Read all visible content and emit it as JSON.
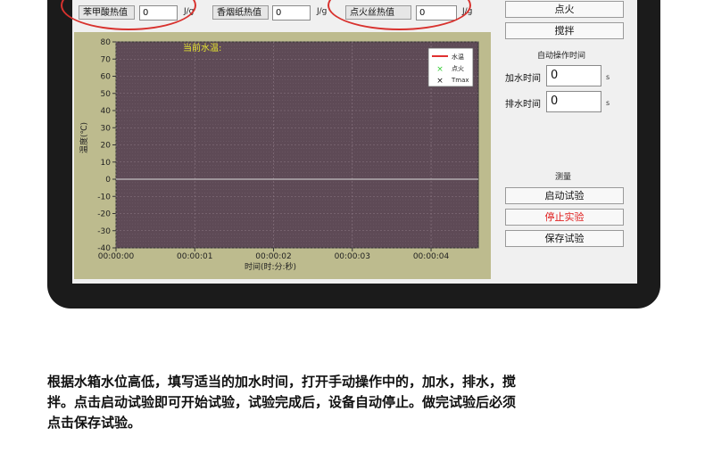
{
  "top_fields": [
    {
      "label": "苯甲酸热值",
      "value": "0",
      "unit": "J/g"
    },
    {
      "label": "香烟纸热值",
      "value": "0",
      "unit": "J/g"
    },
    {
      "label": "点火丝热值",
      "value": "0",
      "unit": "J/g"
    }
  ],
  "right_panel": {
    "ignite_label": "点火",
    "stir_label": "搅拌",
    "auto_title": "自动操作时间",
    "add_water_label": "加水时间",
    "add_water_value": "0",
    "add_water_unit": "s",
    "drain_label": "排水时间",
    "drain_value": "0",
    "drain_unit": "s",
    "measure_title": "测量",
    "start_label": "启动试验",
    "stop_label": "停止实验",
    "save_label": "保存试验"
  },
  "chart_data": {
    "type": "line",
    "annotation": "当前水温:",
    "xlabel": "时间(时:分:秒)",
    "ylabel": "温度(℃)",
    "x_ticks": [
      "00:00:00",
      "00:00:01",
      "00:00:02",
      "00:00:03",
      "00:00:04"
    ],
    "y_ticks": [
      80,
      70,
      60,
      50,
      40,
      30,
      20,
      10,
      0,
      -10,
      -20,
      -30,
      -40
    ],
    "ylim": [
      -40,
      80
    ],
    "xlim": [
      0,
      4.6
    ],
    "grid": true,
    "legend_position": "top-right",
    "legend": [
      {
        "name": "水温",
        "marker": "line",
        "color": "#e03030"
      },
      {
        "name": "点火",
        "marker": "x",
        "color": "#33cc33"
      },
      {
        "name": "Tmax",
        "marker": "x",
        "color": "#111111"
      }
    ],
    "series": [
      {
        "name": "水温",
        "x": [
          0,
          4.6
        ],
        "y": [
          0,
          0
        ],
        "color": "#dddddd"
      }
    ]
  },
  "caption_lines": [
    "根据水箱水位高低，填写适当的加水时间，打开手动操作中的，加水，排水，搅",
    "拌。点击启动试验即可开始试验，试验完成后，设备自动停止。做完试验后必须",
    "点击保存试验。"
  ]
}
